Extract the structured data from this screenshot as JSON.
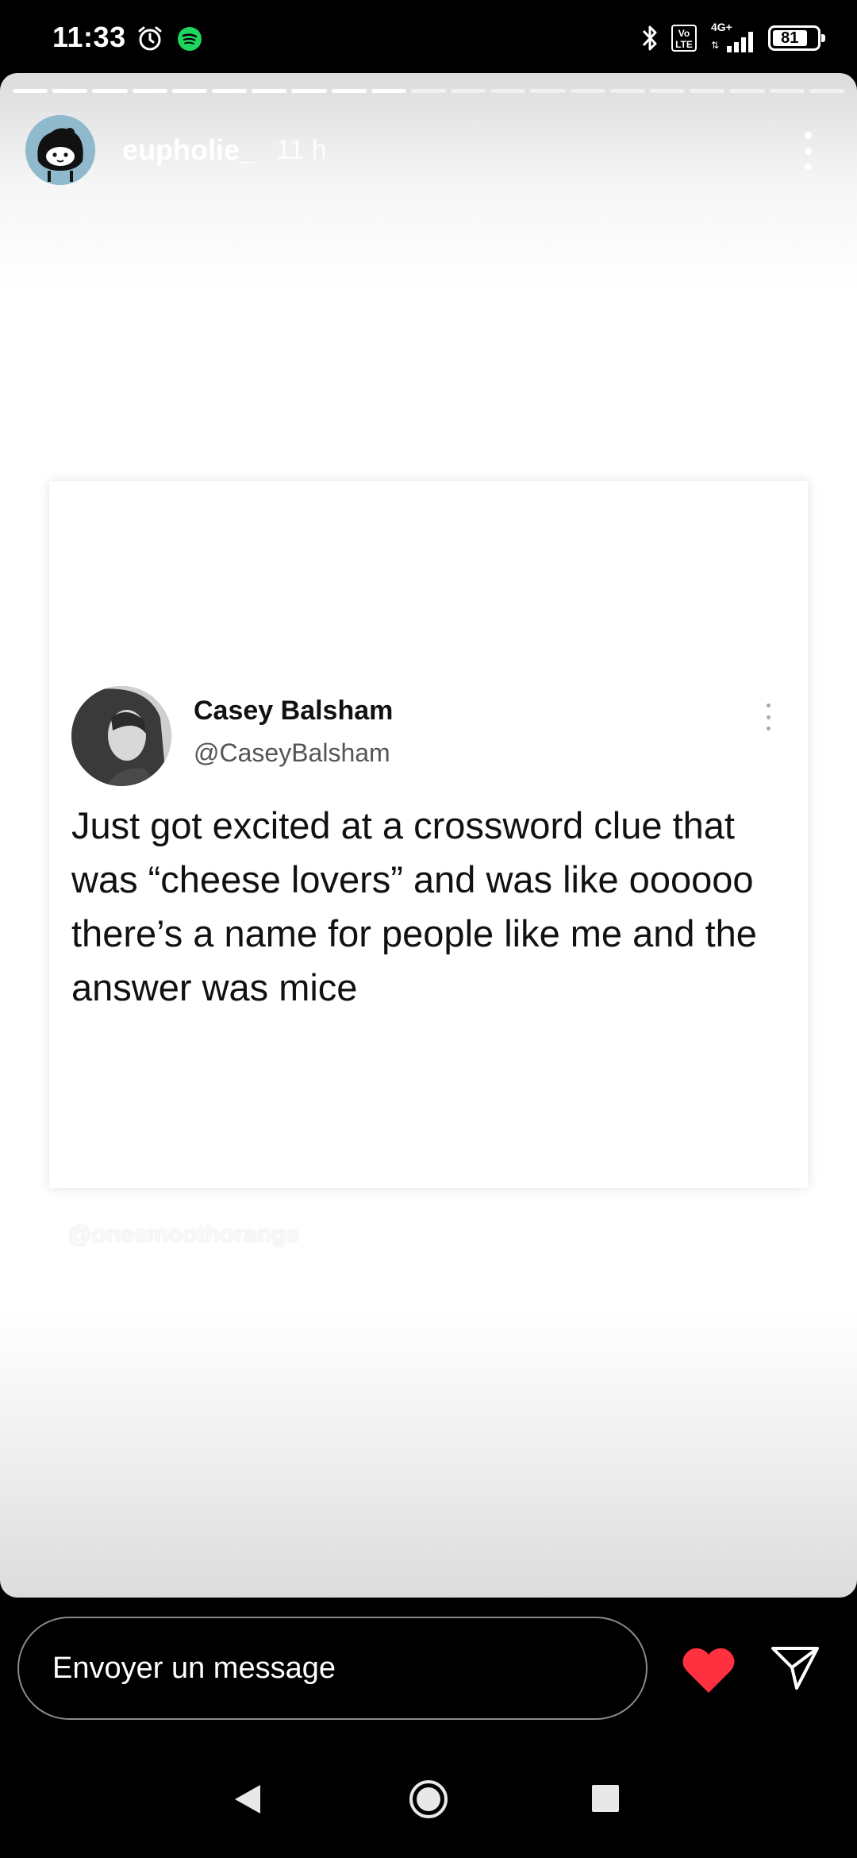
{
  "status_bar": {
    "time": "11:33",
    "network_type": "4G+",
    "volte_label": "Vo\nLTE",
    "battery_level": "81",
    "icons": [
      "alarm-icon",
      "spotify-icon",
      "bluetooth-icon",
      "volte-icon",
      "signal-icon",
      "battery-icon"
    ]
  },
  "story": {
    "progress": {
      "total_segments": 21,
      "viewed_segments": 10
    },
    "username": "eupholie_",
    "timestamp": "11 h",
    "colors": {
      "progress_active": "#ffffff",
      "header_text": "#ffffff"
    }
  },
  "tweet": {
    "author_name": "Casey Balsham",
    "author_handle": "@CaseyBalsham",
    "text": "Just got excited at a crossword clue that was “cheese lovers” and was like oooooo there’s a name for people like me and the answer was mice"
  },
  "watermark": "@onesmoothorange",
  "reply_bar": {
    "message_placeholder": "Envoyer un message",
    "heart_color": "#ff3040"
  },
  "nav_bar": {
    "icons": [
      "back-icon",
      "home-icon",
      "recents-icon"
    ]
  }
}
